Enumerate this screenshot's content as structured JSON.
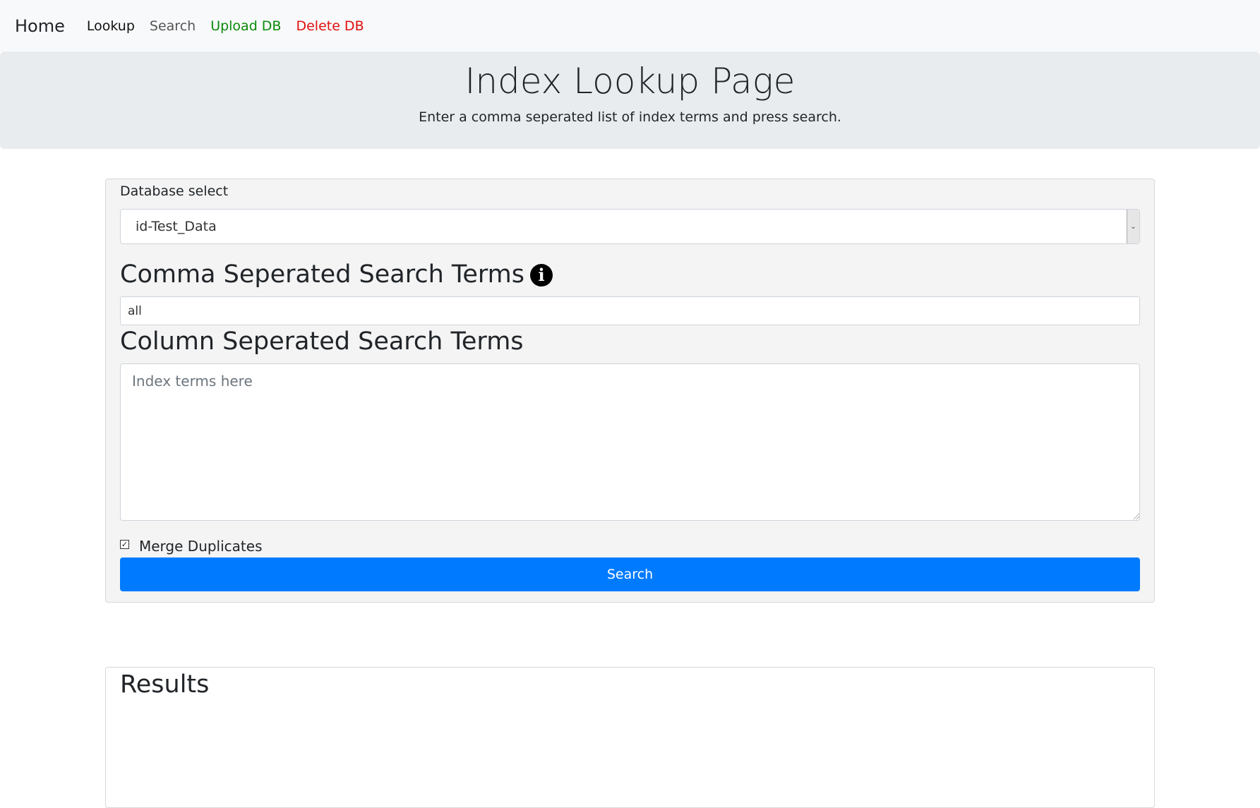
{
  "nav": {
    "brand": "Home",
    "links": [
      {
        "label": "Lookup",
        "color": "#111111"
      },
      {
        "label": "Search",
        "color": "#555555"
      },
      {
        "label": "Upload DB",
        "color": "#0a8a0a"
      },
      {
        "label": "Delete DB",
        "color": "#e01010"
      }
    ]
  },
  "header": {
    "title": "Index Lookup Page",
    "subtitle": "Enter a comma seperated list of index terms and press search."
  },
  "form": {
    "database_label": "Database select",
    "database_selected": "id-Test_Data",
    "select_arrow_icon": "chevron-down-icon",
    "comma_title": "Comma Seperated Search Terms",
    "info_icon": "info-icon",
    "comma_value": "all",
    "column_title": "Column Seperated Search Terms",
    "column_placeholder": "Index terms here",
    "column_value": "",
    "merge_label": "Merge Duplicates",
    "merge_checked": true,
    "search_label": "Search",
    "accent_color": "#007bff"
  },
  "results": {
    "title": "Results"
  }
}
